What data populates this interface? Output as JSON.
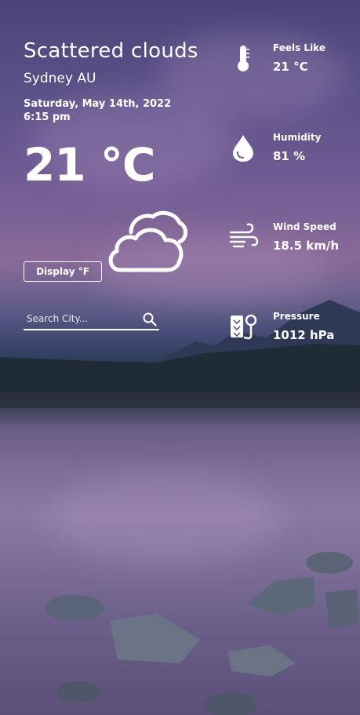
{
  "weather": {
    "description": "Scattered clouds",
    "location": "Sydney AU",
    "date": "Saturday, May 14th, 2022",
    "time": "6:15 pm",
    "temperature": "21 °C",
    "unit_toggle_label": "Display °F",
    "condition_icon": "cloud-icon"
  },
  "search": {
    "placeholder": "Search City...",
    "button_icon": "search-icon"
  },
  "stats": [
    {
      "label": "Feels Like",
      "value": "21 °C",
      "icon": "thermometer-icon"
    },
    {
      "label": "Humidity",
      "value": "81 %",
      "icon": "water-drop-icon"
    },
    {
      "label": "Wind Speed",
      "value": "18.5 km/h",
      "icon": "wind-icon"
    },
    {
      "label": "Pressure",
      "value": "1012 hPa",
      "icon": "pressure-icon"
    }
  ],
  "colors": {
    "text": "#ffffff",
    "sky_top": "#4a4478",
    "sky_glow": "#8a6a98",
    "lake": "#7d6e98"
  }
}
